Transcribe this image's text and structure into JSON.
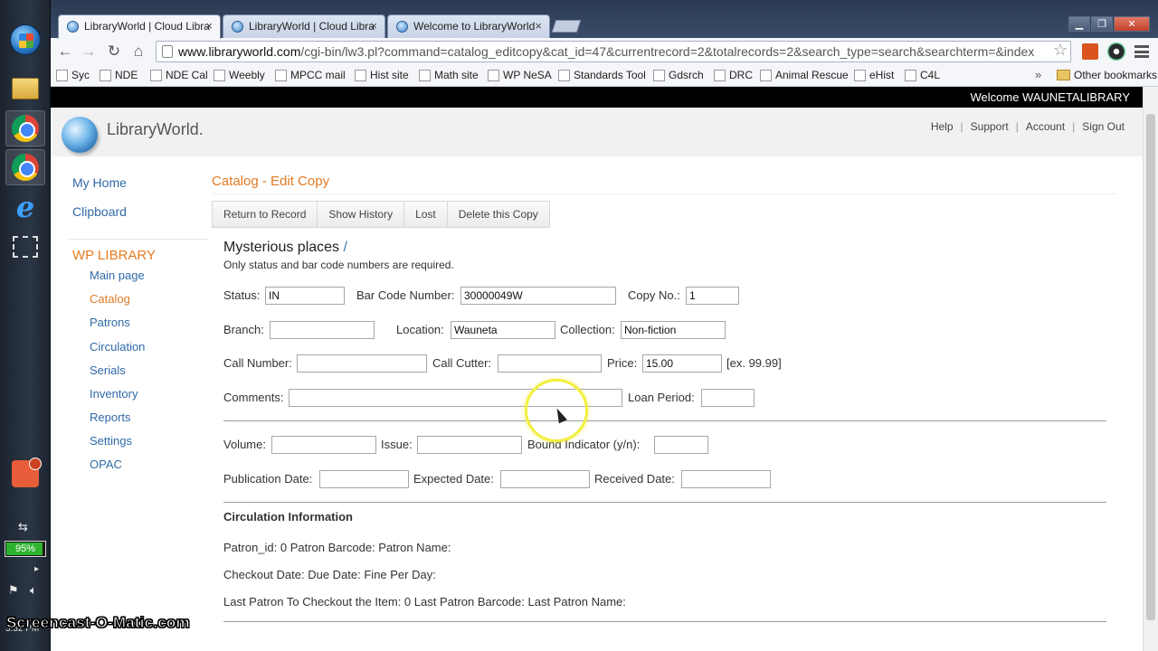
{
  "browser": {
    "tabs": [
      {
        "label": "LibraryWorld | Cloud Libra",
        "active": true
      },
      {
        "label": "LibraryWorld | Cloud Libra",
        "active": false
      },
      {
        "label": "Welcome to LibraryWorld",
        "active": false
      }
    ],
    "url_host": "www.libraryworld.com",
    "url_path": "/cgi-bin/lw3.pl?command=catalog_editcopy&cat_id=47&currentrecord=2&totalrecords=2&search_type=search&searchterm=&index",
    "bookmarks": [
      "Syc",
      "NDE",
      "NDE Cal",
      "Weebly",
      "MPCC mail",
      "Hist site",
      "Math site",
      "WP NeSA",
      "Standards Tool",
      "Gdsrch",
      "DRC",
      "Animal Rescue",
      "eHist",
      "C4L"
    ],
    "bookmarks_more": "»",
    "other_bookmarks": "Other bookmarks"
  },
  "taskbar": {
    "battery": "95%",
    "battery_level": 0.95,
    "clock": "3:32 PM"
  },
  "page": {
    "welcome": "Welcome WAUNETALIBRARY",
    "logo": "LibraryWorld.",
    "top_links": [
      "Help",
      "Support",
      "Account",
      "Sign Out"
    ],
    "sidebar": {
      "top_links": [
        "My Home",
        "Clipboard"
      ],
      "section": "WP LIBRARY",
      "items": [
        "Main page",
        "Catalog",
        "Patrons",
        "Circulation",
        "Serials",
        "Inventory",
        "Reports",
        "Settings",
        "OPAC"
      ]
    },
    "title": "Catalog - Edit Copy",
    "actions": [
      "Return to Record",
      "Show History",
      "Lost",
      "Delete this Copy"
    ],
    "record_title": "Mysterious places",
    "record_slash": "/",
    "record_subtitle": "Only status and bar code numbers are required.",
    "form": {
      "status_label": "Status:",
      "status_value": "IN",
      "barcode_label": "Bar Code Number:",
      "barcode_value": "30000049W",
      "copyno_label": "Copy No.:",
      "copyno_value": "1",
      "branch_label": "Branch:",
      "branch_value": "",
      "location_label": "Location:",
      "location_value": "Wauneta",
      "collection_label": "Collection:",
      "collection_value": "Non-fiction",
      "callnumber_label": "Call Number:",
      "callnumber_value": "",
      "callcutter_label": "Call Cutter:",
      "callcutter_value": "",
      "price_label": "Price:",
      "price_value": "15.00",
      "price_hint": "[ex. 99.99]",
      "comments_label": "Comments:",
      "comments_value": "",
      "loanperiod_label": "Loan Period:",
      "loanperiod_value": "",
      "volume_label": "Volume:",
      "volume_value": "",
      "issue_label": "Issue:",
      "issue_value": "",
      "bound_label": "Bound Indicator (y/n):",
      "bound_value": "",
      "pubdate_label": "Publication Date:",
      "pubdate_value": "",
      "expdate_label": "Expected Date:",
      "expdate_value": "",
      "recdate_label": "Received Date:",
      "recdate_value": ""
    },
    "circulation": {
      "title": "Circulation Information",
      "line1": "Patron_id: 0 Patron Barcode: Patron Name:",
      "line2": "Checkout Date: Due Date: Fine Per Day:",
      "line3": "Last Patron To Checkout the Item: 0 Last Patron Barcode: Last Patron Name:"
    }
  },
  "watermark": "Screencast-O-Matic.com"
}
